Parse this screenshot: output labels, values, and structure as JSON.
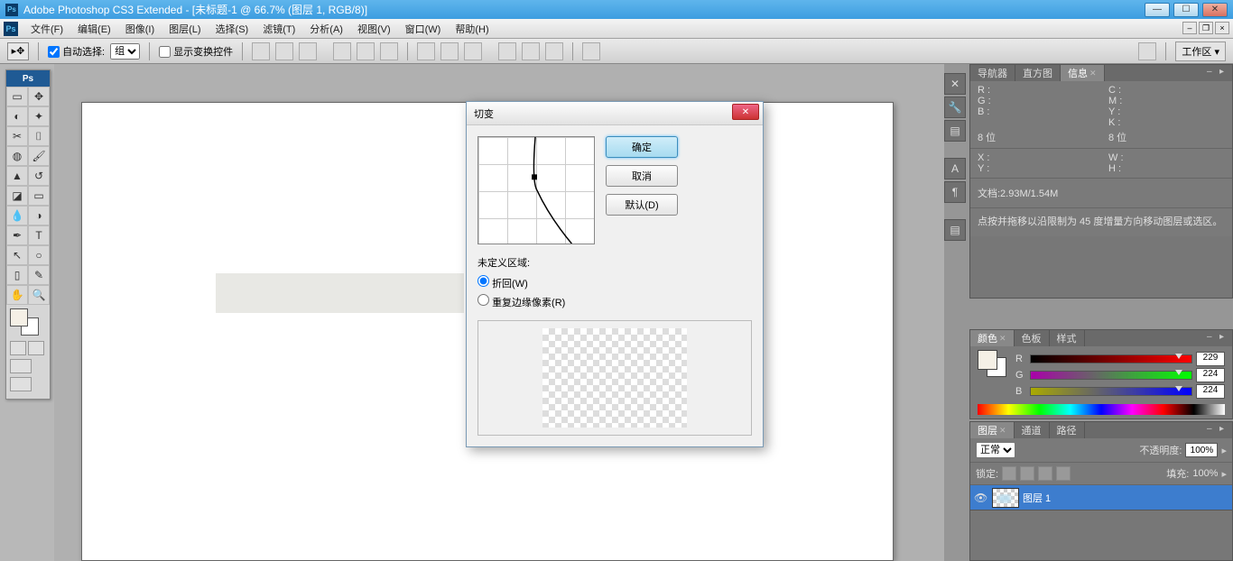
{
  "title": "Adobe Photoshop CS3 Extended - [未标题-1 @ 66.7% (图层 1, RGB/8)]",
  "ps": "Ps",
  "menu": [
    "文件(F)",
    "编辑(E)",
    "图像(I)",
    "图层(L)",
    "选择(S)",
    "滤镜(T)",
    "分析(A)",
    "视图(V)",
    "窗口(W)",
    "帮助(H)"
  ],
  "opt": {
    "autosel": "自动选择:",
    "group": "组",
    "showxf": "显示变换控件",
    "workspace": "工作区 ▾"
  },
  "infoPanel": {
    "tabs": [
      "导航器",
      "直方图",
      "信息"
    ],
    "rgb": {
      "R": "R :",
      "G": "G :",
      "B": "B :"
    },
    "cmyk": {
      "C": "C :",
      "M": "M :",
      "Y": "Y :",
      "K": "K :"
    },
    "bit1": "8 位",
    "bit2": "8 位",
    "xy": {
      "X": "X :",
      "Y": "Y :"
    },
    "wh": {
      "W": "W :",
      "H": "H :"
    },
    "doc": "文档:2.93M/1.54M",
    "hint": "点按并拖移以沿限制为 45 度增量方向移动图层或选区。"
  },
  "colorPanel": {
    "tabs": [
      "颜色",
      "色板",
      "样式"
    ],
    "R": "R",
    "G": "G",
    "B": "B",
    "rv": "229",
    "gv": "224",
    "bv": "224"
  },
  "layersPanel": {
    "tabs": [
      "图层",
      "通道",
      "路径"
    ],
    "blend": "正常",
    "opacityLabel": "不透明度:",
    "opacity": "100%",
    "lock": "锁定:",
    "fillLabel": "填充:",
    "fill": "100%",
    "layerName": "图层 1"
  },
  "dialog": {
    "title": "切变",
    "ok": "确定",
    "cancel": "取消",
    "default": "默认(D)",
    "undef": "未定义区域:",
    "wrap": "折回(W)",
    "repeat": "重复边缘像素(R)"
  }
}
